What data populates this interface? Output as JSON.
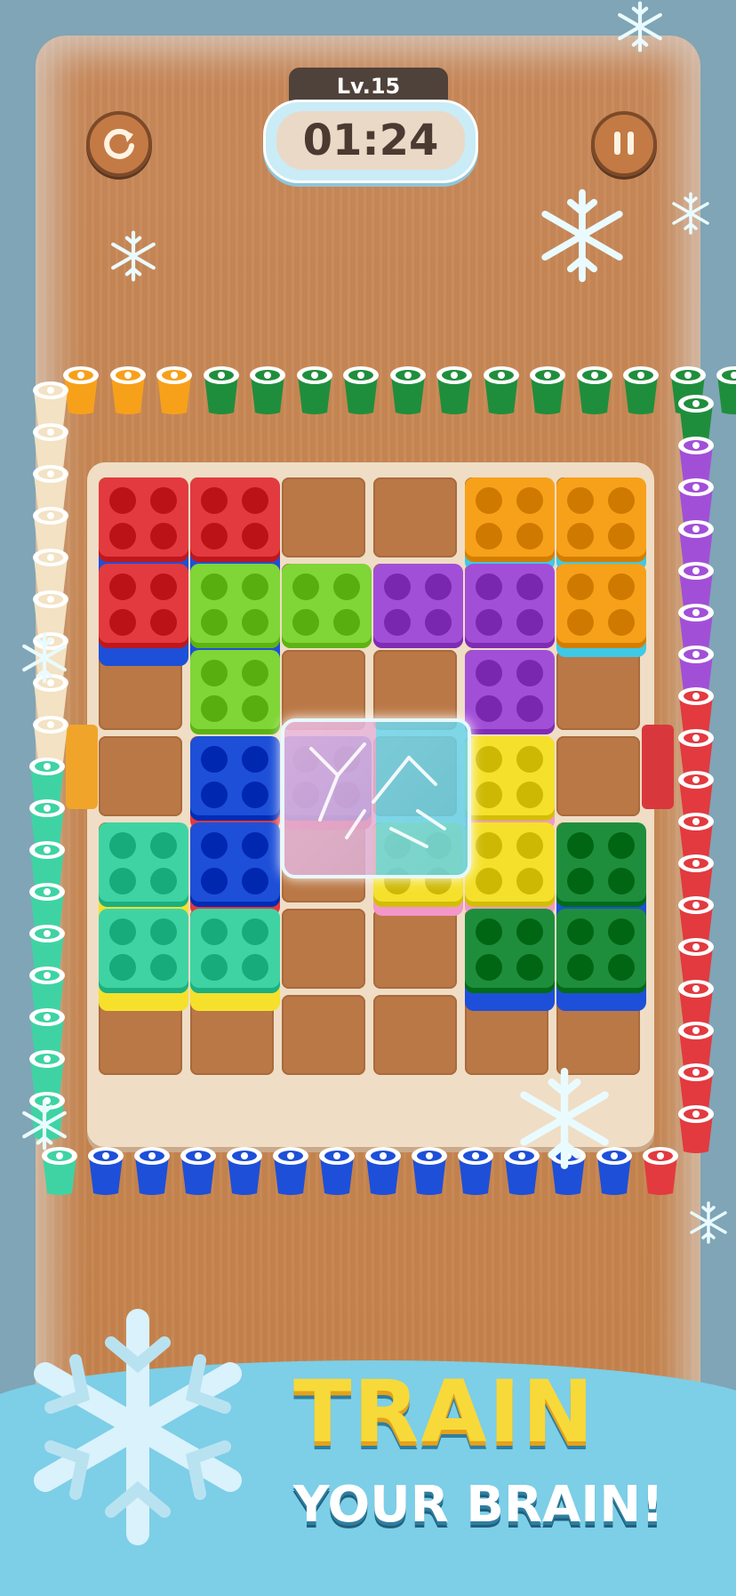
{
  "header": {
    "level_label": "Lv.15",
    "timer": "01:24",
    "restart_icon": "restart-icon",
    "pause_icon": "pause-icon"
  },
  "banner": {
    "line1": "TRAIN",
    "line2": "YOUR BRAIN!"
  },
  "colors": {
    "red": "#e23a3f",
    "orange": "#f7a11a",
    "lime": "#7fd636",
    "purple": "#a24fd8",
    "blue": "#1e4fd8",
    "yellow": "#f5e12c",
    "teal": "#3fd3a4",
    "green": "#1f8e3c",
    "pink": "#f396c9",
    "cyan": "#3ec9e6",
    "cream": "#f3e2c3",
    "wood": "#c6834d"
  },
  "cups": {
    "top": [
      "orange",
      "orange",
      "orange",
      "green",
      "green",
      "green",
      "green",
      "green",
      "green",
      "green",
      "green",
      "green",
      "green",
      "green",
      "green"
    ],
    "left": [
      "cream",
      "cream",
      "cream",
      "cream",
      "cream",
      "cream",
      "cream",
      "cream",
      "cream",
      "teal",
      "teal",
      "teal",
      "teal",
      "teal",
      "teal",
      "teal",
      "teal",
      "teal"
    ],
    "right": [
      "green",
      "purple",
      "purple",
      "purple",
      "purple",
      "purple",
      "purple",
      "red",
      "red",
      "red",
      "red",
      "red",
      "red",
      "red",
      "red",
      "red",
      "red",
      "red"
    ],
    "bottom": [
      "teal",
      "blue",
      "blue",
      "blue",
      "blue",
      "blue",
      "blue",
      "blue",
      "blue",
      "blue",
      "blue",
      "blue",
      "blue",
      "red"
    ]
  }
}
